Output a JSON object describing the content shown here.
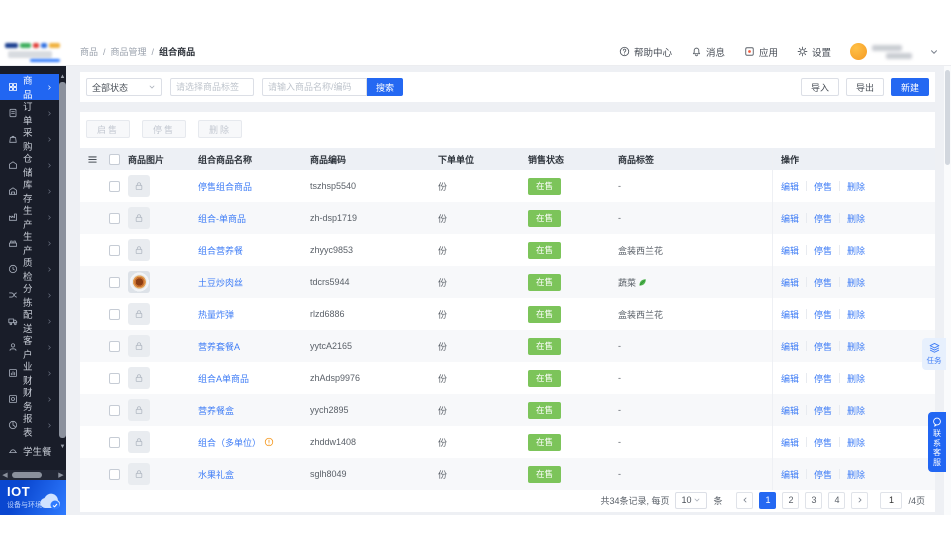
{
  "header": {
    "breadcrumb": [
      "商品",
      "商品管理",
      "组合商品"
    ],
    "separator": "/",
    "nav": [
      {
        "label": "帮助中心",
        "icon": "help-icon"
      },
      {
        "label": "消息",
        "icon": "bell-icon"
      },
      {
        "label": "应用",
        "icon": "apps-icon"
      },
      {
        "label": "设置",
        "icon": "gear-icon"
      }
    ]
  },
  "sidebar": {
    "items": [
      {
        "label": "商品",
        "icon": "goods-icon",
        "active": true,
        "chevron": true
      },
      {
        "label": "订单",
        "icon": "orders-icon",
        "chevron": true
      },
      {
        "label": "采购",
        "icon": "purchase-icon",
        "chevron": true
      },
      {
        "label": "仓储",
        "icon": "storage-icon",
        "chevron": true
      },
      {
        "label": "库存",
        "icon": "inventory-icon",
        "chevron": true
      },
      {
        "label": "生产",
        "icon": "production-icon",
        "chevron": true
      },
      {
        "label": "生产",
        "icon": "production2-icon",
        "chevron": true
      },
      {
        "label": "质检",
        "icon": "quality-icon",
        "chevron": true
      },
      {
        "label": "分拣",
        "icon": "sorting-icon",
        "chevron": true
      },
      {
        "label": "配送",
        "icon": "delivery-icon",
        "chevron": true
      },
      {
        "label": "客户",
        "icon": "customer-icon",
        "chevron": true
      },
      {
        "label": "业财",
        "icon": "bizfin-icon",
        "chevron": true
      },
      {
        "label": "财务",
        "icon": "finance-icon",
        "chevron": true
      },
      {
        "label": "报表",
        "icon": "report-icon",
        "chevron": true
      },
      {
        "label": "学生餐",
        "icon": "meal-icon",
        "chevron": false
      }
    ],
    "iot": {
      "title": "IOT",
      "subtitle": "设备与环境"
    }
  },
  "filters": {
    "status_value": "全部状态",
    "tag_placeholder": "请选择商品标签",
    "keyword_placeholder": "请输入商品名称/编码",
    "search_label": "搜索",
    "import_label": "导入",
    "export_label": "导出",
    "create_label": "新建"
  },
  "toolbar": {
    "enable_label": "启售",
    "stop_label": "停售",
    "delete_label": "删除"
  },
  "table": {
    "columns": [
      "商品图片",
      "组合商品名称",
      "商品编码",
      "下单单位",
      "销售状态",
      "商品标签",
      "操作"
    ],
    "actions": [
      "编辑",
      "停售",
      "删除"
    ],
    "rows": [
      {
        "name": "停售组合商品",
        "code": "tszhsp5540",
        "unit": "份",
        "status": "在售",
        "tag": "-",
        "photo": false,
        "warning": false,
        "leaf": false
      },
      {
        "name": "组合-单商品",
        "code": "zh-dsp1719",
        "unit": "份",
        "status": "在售",
        "tag": "-",
        "photo": false,
        "warning": false,
        "leaf": false
      },
      {
        "name": "组合营养餐",
        "code": "zhyyc9853",
        "unit": "份",
        "status": "在售",
        "tag": "盒装西兰花",
        "photo": false,
        "warning": false,
        "leaf": false
      },
      {
        "name": "土豆炒肉丝",
        "code": "tdcrs5944",
        "unit": "份",
        "status": "在售",
        "tag": "蔬菜",
        "photo": true,
        "warning": false,
        "leaf": true
      },
      {
        "name": "热量炸弹",
        "code": "rlzd6886",
        "unit": "份",
        "status": "在售",
        "tag": "盒装西兰花",
        "photo": false,
        "warning": false,
        "leaf": false
      },
      {
        "name": "营养套餐A",
        "code": "yytcA2165",
        "unit": "份",
        "status": "在售",
        "tag": "-",
        "photo": false,
        "warning": false,
        "leaf": false
      },
      {
        "name": "组合A单商品",
        "code": "zhAdsp9976",
        "unit": "份",
        "status": "在售",
        "tag": "-",
        "photo": false,
        "warning": false,
        "leaf": false
      },
      {
        "name": "营养餐盒",
        "code": "yych2895",
        "unit": "份",
        "status": "在售",
        "tag": "-",
        "photo": false,
        "warning": false,
        "leaf": false
      },
      {
        "name": "组合（多单位）",
        "code": "zhddw1408",
        "unit": "份",
        "status": "在售",
        "tag": "-",
        "photo": false,
        "warning": true,
        "leaf": false
      },
      {
        "name": "水果礼盒",
        "code": "sglh8049",
        "unit": "份",
        "status": "在售",
        "tag": "-",
        "photo": false,
        "warning": false,
        "leaf": false
      }
    ]
  },
  "pagination": {
    "total_text": "共34条记录, 每页",
    "page_size": "10",
    "unit_label": "条",
    "pages": [
      "1",
      "2",
      "3",
      "4"
    ],
    "current": "1",
    "jump_value": "1",
    "suffix": "/4页"
  },
  "floaters": {
    "task_label": "任务",
    "service_label": "联系客服"
  },
  "colors": {
    "primary": "#2468f2",
    "badge_green": "#7cc45a",
    "link_blue": "#3f7df6",
    "sidebar_bg": "#191d29"
  }
}
